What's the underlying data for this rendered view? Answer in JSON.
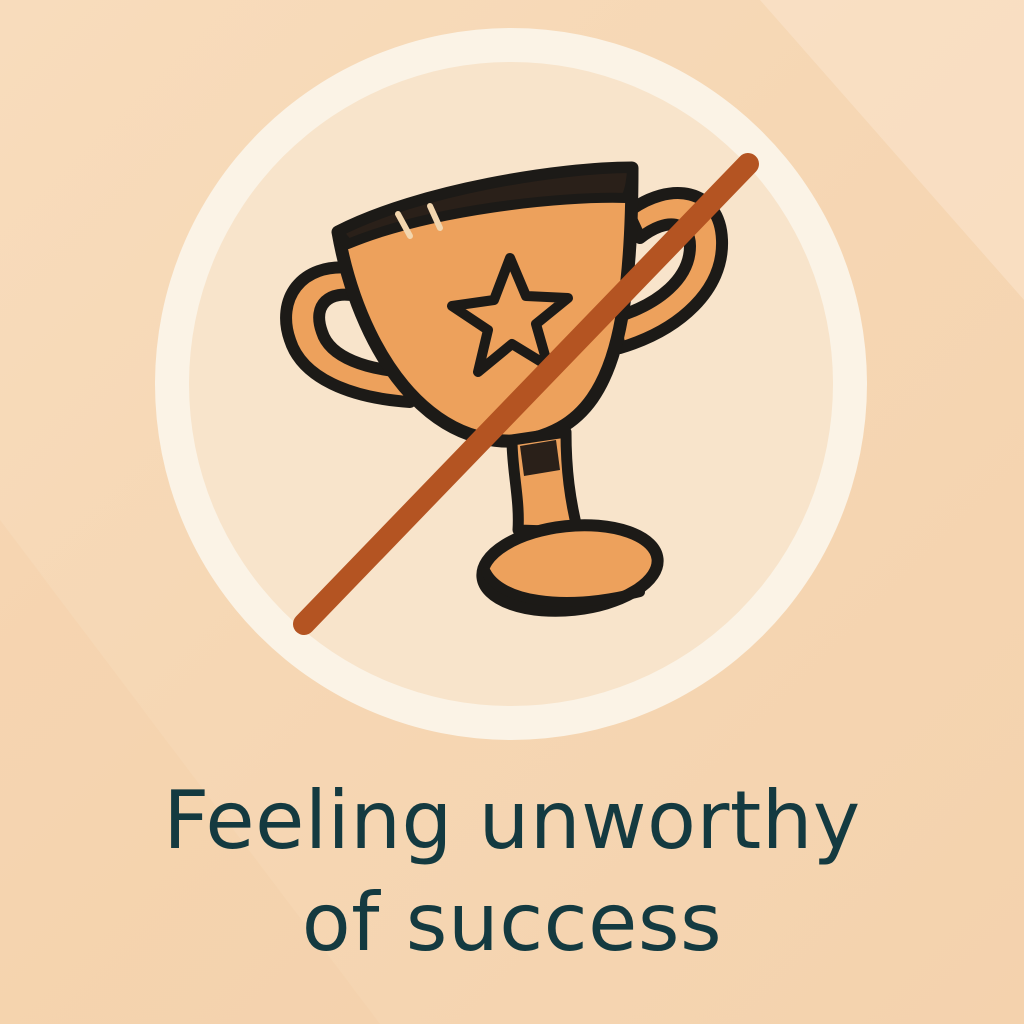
{
  "caption": {
    "line1": "Feeling unworthy",
    "line2": "of success"
  },
  "icons": {
    "main": "crossed-out-trophy-icon",
    "star": "star-icon"
  },
  "colors": {
    "background": "#f6d7b4",
    "circle_ring": "#fbf2e4",
    "circle_fill": "#f9e5cc",
    "trophy_fill": "#eda15c",
    "outline": "#1c1a17",
    "slash": "#b45422",
    "caption_text": "#143a40"
  }
}
